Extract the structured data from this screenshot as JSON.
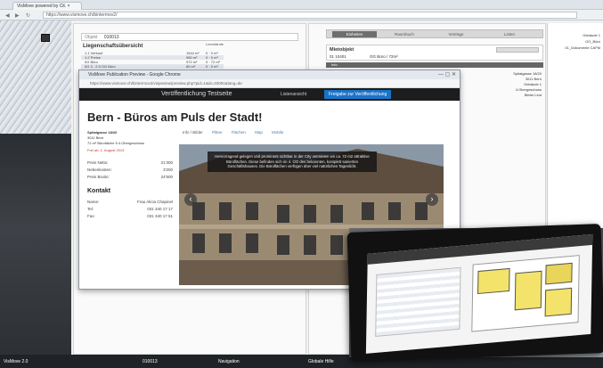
{
  "browser": {
    "tab_title": "VisMove powered by Cit. ×",
    "url": "https://www.vismove.ch/bintermov2/"
  },
  "left_panel": {
    "objekt_label": "Objekt",
    "objekt_value": "010013",
    "section_title": "Liegenschaftsübersicht",
    "col_header": "Leerstände",
    "rows": [
      {
        "name": "1.1 Verkauf",
        "a": "1544 m²",
        "b": "0 · 0 m²"
      },
      {
        "name": "1.2 Preise",
        "a": "980 m²",
        "b": "0 · 0 m²"
      },
      {
        "name": "0G Büro",
        "a": "972 m²",
        "b": "0 · 72 m²"
      },
      {
        "name": "0G 3 · 2.5 OG Büro",
        "a": "80 m²",
        "b": "0 · 0 m²"
      }
    ]
  },
  "right_panel": {
    "tabs": [
      "Einheiten",
      "Raumbuch",
      "Verträge",
      "Listen"
    ],
    "mietobjekt_title": "Mietobjekt",
    "mietobjekt_id": "01 10401",
    "mietobjekt_desc": "OG Büro  /  72m²",
    "info_label": "Info",
    "address_lines": [
      "Spitalgasse 18/20",
      "3011 Bern",
      "Gebäude 1",
      "4.Obergeschoss",
      "Bieter Lind"
    ]
  },
  "far_right": {
    "items": [
      "Gebäude 1",
      "OG_Büro",
      "01_Dokumente CAFM"
    ]
  },
  "popup": {
    "window_title": "VisMove Publication Preview - Google Chrome",
    "url": "https://www.vismove.ch/bintermov2/vispeview/preview.php?pid=1&id=20091&lang=de",
    "header_title": "Veröffentlichung Testseite",
    "header_link": "Listenansicht",
    "header_button": "Freigabe zur Veröffentlichung",
    "headline": "Bern - Büros am Puls der Stadt!",
    "address": [
      "Spitalgasse 18/20",
      "3011 Bern",
      "72 m² Bürofläche 5 4.Obergeschoss"
    ],
    "availability": "Frei ab: 1. August 2013",
    "prices": [
      {
        "label": "Preis Netto:",
        "value": "21'300"
      },
      {
        "label": "Nebenkosten:",
        "value": "3'200"
      },
      {
        "label": "Preis Brutto:",
        "value": "24'500"
      }
    ],
    "contact_title": "Kontakt",
    "contact": [
      {
        "label": "Name:",
        "value": "Frau Alicia Chapinel"
      },
      {
        "label": "Tel:",
        "value": "031 340 17 17"
      },
      {
        "label": "Fax:",
        "value": "031 340 17 51"
      }
    ],
    "tabs": [
      "Info / Bilder",
      "Pläne",
      "Flächen",
      "Map",
      "Mobile"
    ],
    "caption": "Hervorragend gelegen und prominent sichtbar in der City vermieten wir ca. 72 m2 attraktive Büroflächen. Diese befinden sich im 4. OG des bekannten, komplett sanierten Geschäftshauses. Die Büroflächen verfügen über viel natürliches Tageslicht.",
    "prev": "‹",
    "next": "›"
  },
  "statusbar": {
    "items": [
      "VisMove 2.0",
      "010013",
      "Navigation",
      "Globale Hilfe"
    ]
  }
}
